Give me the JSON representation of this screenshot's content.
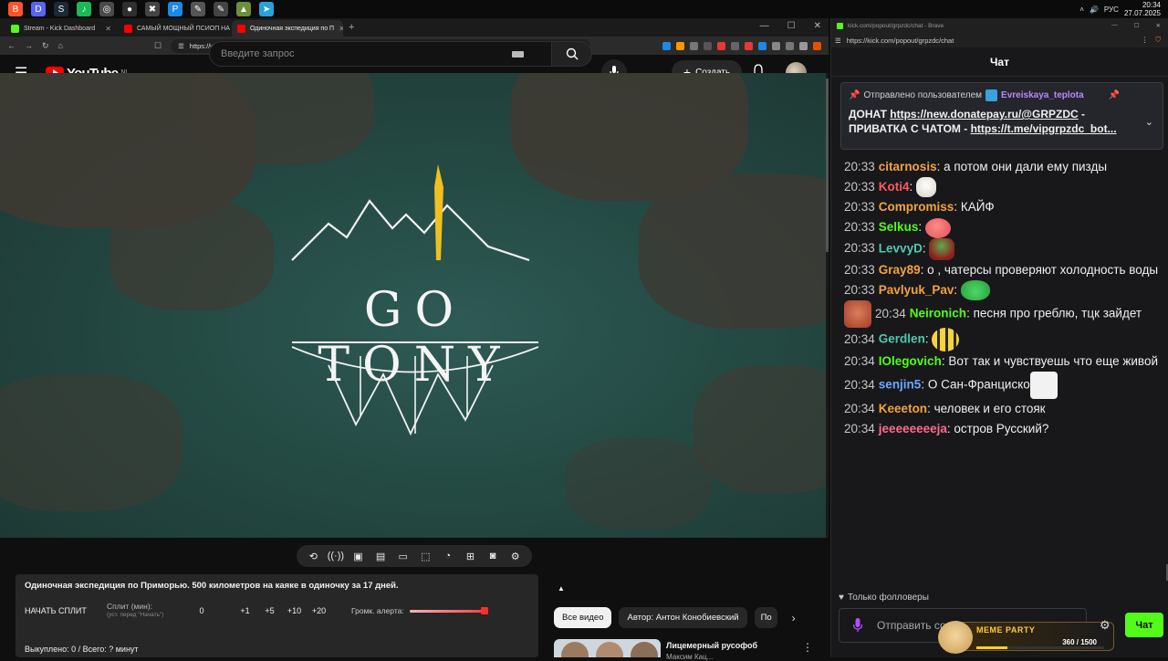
{
  "taskbar": {
    "icons": [
      {
        "name": "brave-icon",
        "color": "#fb542b",
        "glyph": "B"
      },
      {
        "name": "discord-icon",
        "color": "#5865f2",
        "glyph": "D"
      },
      {
        "name": "steam-icon",
        "color": "#1b2838",
        "glyph": "S"
      },
      {
        "name": "spotify-icon",
        "color": "#1db954",
        "glyph": "♪"
      },
      {
        "name": "chrome-icon",
        "color": "#4a4a4a",
        "glyph": "◎"
      },
      {
        "name": "obs-icon",
        "color": "#302e31",
        "glyph": "●"
      },
      {
        "name": "app-icon",
        "color": "#444444",
        "glyph": "✖"
      },
      {
        "name": "app-icon",
        "color": "#1e88e5",
        "glyph": "P"
      },
      {
        "name": "app-icon",
        "color": "#555555",
        "glyph": "✎"
      },
      {
        "name": "app-icon",
        "color": "#444444",
        "glyph": "✎"
      },
      {
        "name": "app-icon",
        "color": "#6d8f3a",
        "glyph": "▲"
      },
      {
        "name": "telegram-icon",
        "color": "#2aa1da",
        "glyph": "➤"
      }
    ],
    "lang": "РУС",
    "time": "20:34",
    "date": "27.07.2025"
  },
  "left_browser": {
    "tabs": [
      {
        "label": "Stream - Kick Dashboard",
        "fav_color": "#53fc18",
        "active": false
      },
      {
        "label": "САМЫЙ МОЩНЫЙ ПСИОП НА РУ",
        "fav_color": "#ff0000",
        "active": false
      },
      {
        "label": "Одиночная экспедиция по П",
        "fav_color": "#ff0000",
        "active": true
      }
    ],
    "url": "https://www.youtube.com/watch?v=gpgcC3nxFiw"
  },
  "youtube": {
    "logo": "YouTube",
    "region": "NL",
    "search_placeholder": "Введите запрос",
    "create_label": "Создать",
    "video_overlay_text": "GO TONY"
  },
  "split": {
    "title": "Одиночная экспедиция по Приморью. 500 километров на каяке в одиночку за 17 дней.",
    "start_label": "НАЧАТЬ СПЛИТ",
    "minutes_label": "Сплит (мин):",
    "minutes_hint": "(уст. перед \"Начать\")",
    "minutes_value": "0",
    "steps": [
      "+1",
      "+5",
      "+10",
      "+20"
    ],
    "volume_label": "Громк. алерта:",
    "volume_level": 1.0,
    "footer": "Выкуплено: 0 / Всего: ? минут"
  },
  "chips": [
    "Все видео",
    "Автор: Антон Конобиевский",
    "По"
  ],
  "recommendation": {
    "title": "Лицемерный русофоб",
    "subtitle": "Максим Кац..."
  },
  "chat": {
    "window_title": "kick.com/popout/grpzdc/chat - Brave",
    "url": "https://kick.com/popout/grpzdc/chat",
    "header": "Чат",
    "pinned": {
      "sent_by": "Отправлено пользователем",
      "user": "Evreiskaya_teplota",
      "body_text1": "ДОНАТ ",
      "link1": "https://new.donatepay.ru/@GRPZDC",
      "body_text2": " - ПРИВАТКА С ЧАТОМ - ",
      "link2": "https://t.me/vipgrpzdc_bot..."
    },
    "messages": [
      {
        "time": "20:33",
        "user": "citarnosis",
        "color": "#f4a23b",
        "text": "а потом они дали ему пизды",
        "emote": ""
      },
      {
        "time": "20:33",
        "user": "Koti4",
        "color": "#ff5a5a",
        "text": "",
        "emote": "cat"
      },
      {
        "time": "20:33",
        "user": "Compromiss",
        "color": "#f4a23b",
        "text": "КАЙФ",
        "emote": ""
      },
      {
        "time": "20:33",
        "user": "Selkus",
        "color": "#53fc18",
        "text": "",
        "emote": "blob"
      },
      {
        "time": "20:33",
        "user": "LevvyD",
        "color": "#4ec9b0",
        "text": "",
        "emote": "pepe"
      },
      {
        "time": "20:33",
        "user": "Gray89",
        "color": "#f4a23b",
        "text": "о , чатерсы проверяют холодность воды",
        "emote": ""
      },
      {
        "time": "20:33",
        "user": "Pavlyuk_Pav",
        "color": "#f4a23b",
        "text": "",
        "emote": "frog"
      },
      {
        "time": "20:34",
        "user": "Neironich",
        "color": "#53fc18",
        "text": "песня про греблю, тцк зайдет",
        "emote": "face"
      },
      {
        "time": "20:34",
        "user": "Gerdlen",
        "color": "#4ec9b0",
        "text": "",
        "emote": "bee"
      },
      {
        "time": "20:34",
        "user": "IOlegovich",
        "color": "#53fc18",
        "text": "Вот так и чувствуешь что еще живой",
        "emote": ""
      },
      {
        "time": "20:34",
        "user": "senjin5",
        "color": "#6aa9ff",
        "text": "О Сан-Франциско",
        "emote": "smile"
      },
      {
        "time": "20:34",
        "user": "Keeeton",
        "color": "#f4a23b",
        "text": "человек и его стояк",
        "emote": ""
      },
      {
        "time": "20:34",
        "user": "jeeeeeeeeja",
        "color": "#ff6b8a",
        "text": "остров Русский?",
        "emote": ""
      }
    ],
    "followers_only": "Только фолловеры",
    "input_placeholder": "Отправить сообщение",
    "send_label": "Чат",
    "meme_party": {
      "title": "MEME PARTY",
      "count": "360 / 1500",
      "progress": 0.24
    }
  }
}
